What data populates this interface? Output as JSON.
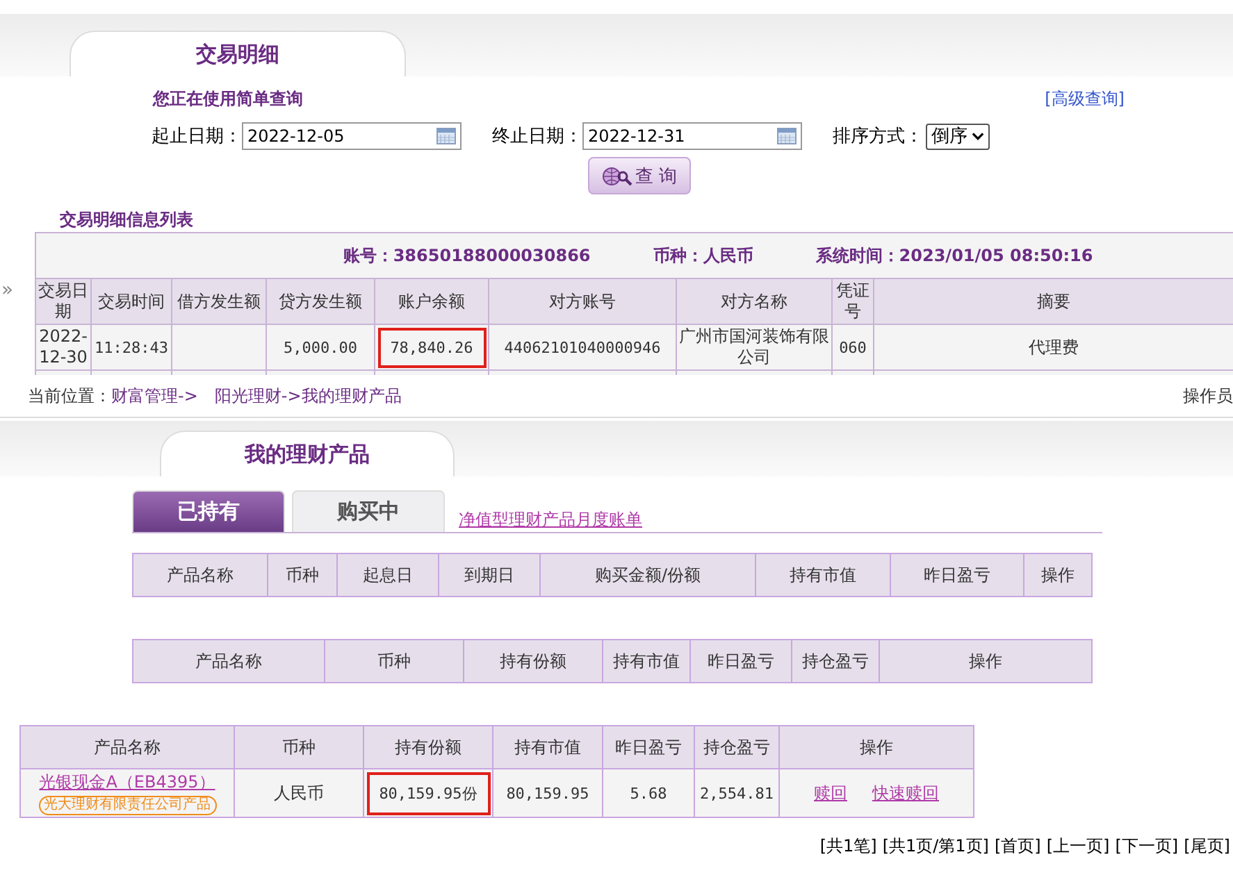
{
  "transactions_panel": {
    "title": "交易明细",
    "query_mode": "您正在使用简单查询",
    "advanced_link": "[高级查询]",
    "start_date": {
      "label": "起止日期：",
      "value": "2022-12-05"
    },
    "end_date": {
      "label": "终止日期：",
      "value": "2022-12-31"
    },
    "sort": {
      "label": "排序方式：",
      "value": "倒序"
    },
    "search_button": "查 询",
    "list_title": "交易明细信息列表",
    "expand_marker": "»",
    "account_info": [
      "账号：38650188000030866",
      "币种：人民币",
      "系统时间：2023/01/05 08:50:16"
    ],
    "columns": [
      "交易日期",
      "交易时间",
      "借方发生额",
      "贷方发生额",
      "账户余额",
      "对方账号",
      "对方名称",
      "凭证号",
      "摘要"
    ],
    "rows": [
      {
        "cells": [
          {
            "text": "2022-12-30",
            "highlighted": false
          },
          {
            "text": "11:28:43",
            "highlighted": false
          },
          {
            "text": "",
            "highlighted": false
          },
          {
            "text": "5,000.00",
            "highlighted": false
          },
          {
            "text": "78,840.26",
            "highlighted": true
          },
          {
            "text": "44062101040000946",
            "highlighted": false
          },
          {
            "text": "广州市国河装饰有限公司",
            "highlighted": false
          },
          {
            "text": "060",
            "highlighted": false
          },
          {
            "text": "代理费",
            "highlighted": false
          }
        ]
      }
    ]
  },
  "breadcrumb": {
    "label": "当前位置：",
    "links": [
      "财富管理->",
      "阳光理财->我的理财产品"
    ],
    "right_text": "操作员"
  },
  "products_panel": {
    "title": "我的理财产品",
    "tabs": [
      {
        "label": "已持有",
        "selected": true
      },
      {
        "label": "购买中",
        "selected": false
      }
    ],
    "statement_link": "净值型理财产品月度账单",
    "table_1_columns": [
      "产品名称",
      "币种",
      "起息日",
      "到期日",
      "购买金额/份额",
      "持有市值",
      "昨日盈亏",
      "操作"
    ],
    "table_2_columns": [
      "产品名称",
      "币种",
      "持有份额",
      "持有市值",
      "昨日盈亏",
      "持仓盈亏",
      "操作"
    ],
    "table_3": {
      "columns": [
        "产品名称",
        "币种",
        "持有份额",
        "持有市值",
        "昨日盈亏",
        "持仓盈亏",
        "操作"
      ],
      "rows": [
        {
          "cells": [
            {
              "kind": "product",
              "text": "光银现金A（EB4395）",
              "badge": "光大理财有限责任公司产品",
              "highlighted": false
            },
            {
              "kind": "text",
              "text": "人民币",
              "highlighted": false
            },
            {
              "kind": "text",
              "text": "80,159.95份",
              "highlighted": true
            },
            {
              "kind": "text",
              "text": "80,159.95",
              "highlighted": false
            },
            {
              "kind": "text",
              "text": "5.68",
              "highlighted": false
            },
            {
              "kind": "text",
              "text": "2,554.81",
              "highlighted": false
            },
            {
              "kind": "actions",
              "links": [
                "赎回",
                "快速赎回"
              ],
              "highlighted": false
            }
          ]
        }
      ]
    },
    "pagination": [
      "[共1笔]",
      "[共1页/第1页]",
      "[首页]",
      "[上一页]",
      "[下一页]",
      "[尾页]"
    ]
  }
}
